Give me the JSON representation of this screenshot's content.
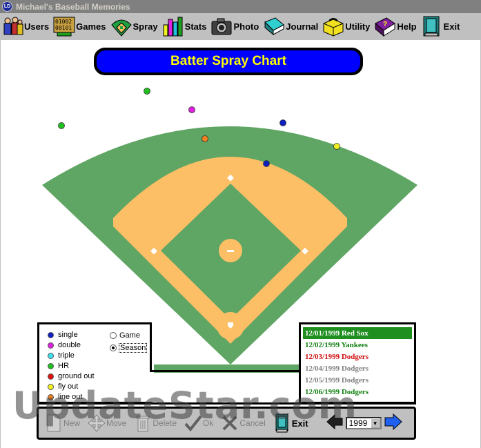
{
  "window": {
    "title": "Michael's Baseball Memories",
    "app_icon_text": "LD"
  },
  "menu": [
    {
      "key": "users",
      "label": "Users",
      "icon": "users-icon"
    },
    {
      "key": "games",
      "label": "Games",
      "icon": "scoreboard-icon",
      "icon_text_top": "01002",
      "icon_text_bottom": "00101"
    },
    {
      "key": "spray",
      "label": "Spray",
      "icon": "field-icon"
    },
    {
      "key": "stats",
      "label": "Stats",
      "icon": "bar-chart-icon"
    },
    {
      "key": "photo",
      "label": "Photo",
      "icon": "camera-icon"
    },
    {
      "key": "journal",
      "label": "Journal",
      "icon": "book-icon"
    },
    {
      "key": "utility",
      "label": "Utility",
      "icon": "toolbox-icon"
    },
    {
      "key": "help",
      "label": "Help",
      "icon": "help-book-icon",
      "icon_text": "?"
    },
    {
      "key": "exit",
      "label": "Exit",
      "icon": "door-icon"
    }
  ],
  "chart": {
    "title": "Batter Spray Chart",
    "colors": {
      "grass": "#5fa564",
      "dirt": "#fcbf66",
      "banner": "#0000ff",
      "banner_text": "#ffff00",
      "base": "#ffffff"
    },
    "hits": [
      {
        "type": "double",
        "color": "#e020e0"
      },
      {
        "type": "HR",
        "color": "#20c020"
      },
      {
        "type": "HR",
        "color": "#20c020"
      },
      {
        "type": "single",
        "color": "#1020c0"
      },
      {
        "type": "line out",
        "color": "#f08020"
      },
      {
        "type": "fly out",
        "color": "#f0f020"
      },
      {
        "type": "single",
        "color": "#1020c0"
      }
    ]
  },
  "legend": {
    "items": [
      {
        "label": "single",
        "color": "#1020c0"
      },
      {
        "label": "double",
        "color": "#e020e0"
      },
      {
        "label": "triple",
        "color": "#40e0f0"
      },
      {
        "label": "HR",
        "color": "#20c020"
      },
      {
        "label": "ground out",
        "color": "#e01010"
      },
      {
        "label": "fly out",
        "color": "#f0f020"
      },
      {
        "label": "line out",
        "color": "#f08020"
      }
    ],
    "modes": [
      {
        "label": "Game",
        "selected": false
      },
      {
        "label": "Season",
        "selected": true
      }
    ]
  },
  "games": [
    {
      "text": "12/01/1999  Red Sox",
      "color": "#ffffff",
      "selected": true
    },
    {
      "text": "12/02/1999  Yankees",
      "color": "#108010",
      "selected": false
    },
    {
      "text": "12/03/1999  Dodgers",
      "color": "#d01010",
      "selected": false
    },
    {
      "text": "12/04/1999  Dodgers",
      "color": "#808080",
      "selected": false
    },
    {
      "text": "12/05/1999  Dodgers",
      "color": "#808080",
      "selected": false
    },
    {
      "text": "12/06/1999  Dodgers",
      "color": "#108010",
      "selected": false
    }
  ],
  "toolbar": {
    "new_label": "New",
    "move_label": "Move",
    "delete_label": "Delete",
    "ok_label": "Ok",
    "cancel_label": "Cancel",
    "exit_label": "Exit",
    "year": "1999"
  },
  "watermark": "UpdateStar.com"
}
